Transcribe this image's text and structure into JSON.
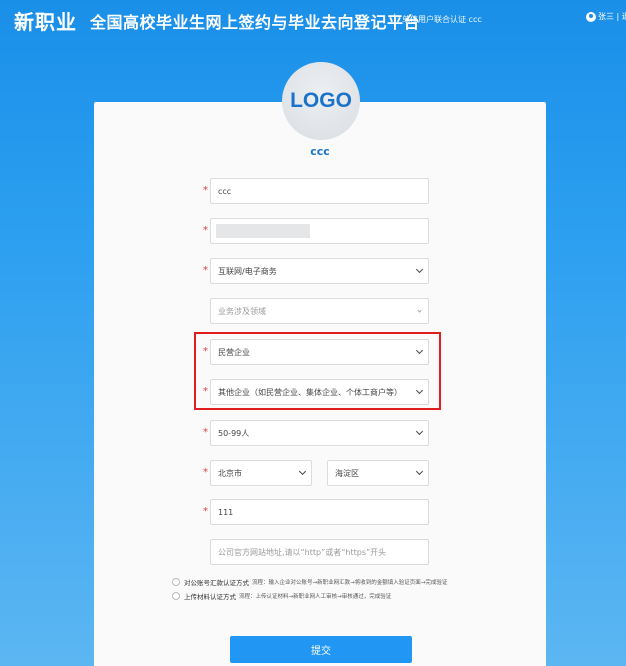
{
  "header": {
    "brand": "新职业",
    "site_title": "全国高校毕业生网上签约与毕业去向登记平台",
    "separator": "|",
    "subtitle": "单位用户联合认证 ccc",
    "user": "张三 | 退"
  },
  "logo": {
    "text": "LOGO"
  },
  "company": {
    "name": "ccc"
  },
  "form": {
    "required_mark": "*",
    "unit_name": "ccc",
    "industry": "互联网/电子商务",
    "business_scope_placeholder": "业务涉及领域",
    "unit_nature": "民营企业",
    "unit_sub_nature": "其他企业（如民营企业、集体企业、个体工商户等）",
    "size": "50-99人",
    "city": "北京市",
    "district": "海淀区",
    "phone": "111",
    "website_placeholder": "公司官方网站地址,请以“http”或者“https”开头"
  },
  "verification": {
    "option1_label": "对公账号汇款认证方式",
    "option1_desc": "流程：输入企业对公账号→新职业网汇款→将收到的金额填入验证页面→完成验证",
    "option2_label": "上传材料认证方式",
    "option2_desc": "流程：上传认证材料→新职业网人工审核→审核通过，完成验证"
  },
  "submit_label": "提交",
  "colors": {
    "accent": "#2196f3",
    "highlight": "#e01e1e"
  }
}
